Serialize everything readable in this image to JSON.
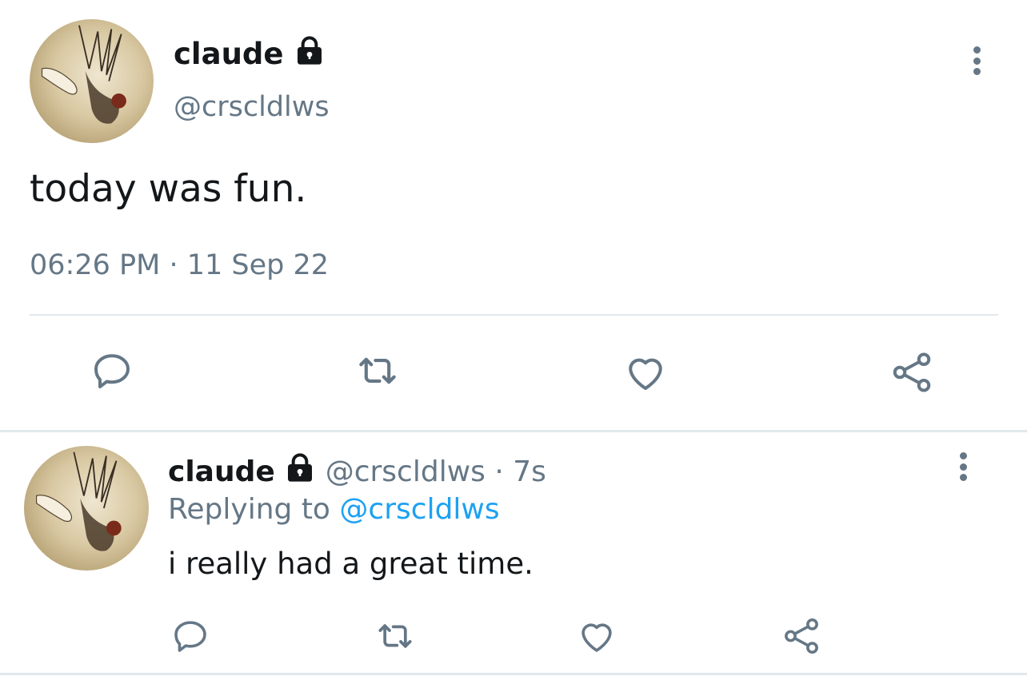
{
  "main_tweet": {
    "author": {
      "name": "claude",
      "handle": "@crscldlws",
      "locked": true
    },
    "text": "today was fun.",
    "time": "06:26 PM",
    "separator": "·",
    "date": "11 Sep 22"
  },
  "reply_tweet": {
    "author": {
      "name": "claude",
      "handle": "@crscldlws",
      "locked": true
    },
    "separator": "·",
    "age": "7s",
    "replying_prefix": "Replying to",
    "replying_handle": "@crscldlws",
    "text": "i really had a great time."
  },
  "actions": [
    "reply-icon",
    "retweet-icon",
    "like-icon",
    "share-icon"
  ],
  "colors": {
    "text": "#14171a",
    "muted": "#657786",
    "link": "#1da1f2",
    "divider": "#e1e8ed"
  }
}
